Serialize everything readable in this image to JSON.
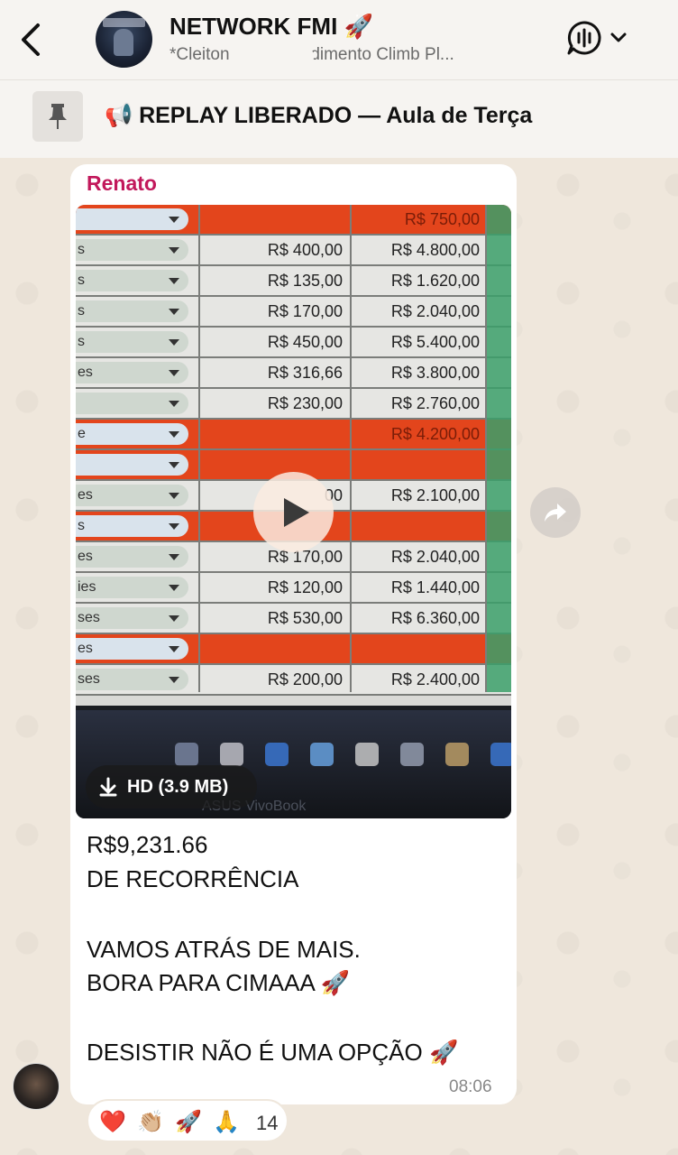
{
  "header": {
    "title": "NETWORK FMI 🚀",
    "subtitle": "*Cleiton ... ia, Atendimento Climb Pl..."
  },
  "pinned": {
    "text": "📢 REPLAY LIBERADO — Aula de Terça"
  },
  "message": {
    "sender": "Renato",
    "video": {
      "download_label": "HD (3.9 MB)",
      "spreadsheet_rows": [
        {
          "type": "red",
          "label": "",
          "col_b": "",
          "col_c": "R$ 750,00"
        },
        {
          "type": "gray",
          "label": "s",
          "col_b": "R$ 400,00",
          "col_c": "R$ 4.800,00"
        },
        {
          "type": "gray",
          "label": "s",
          "col_b": "R$ 135,00",
          "col_c": "R$ 1.620,00"
        },
        {
          "type": "gray",
          "label": "s",
          "col_b": "R$ 170,00",
          "col_c": "R$ 2.040,00"
        },
        {
          "type": "gray",
          "label": "s",
          "col_b": "R$ 450,00",
          "col_c": "R$ 5.400,00"
        },
        {
          "type": "gray",
          "label": "es",
          "col_b": "R$ 316,66",
          "col_c": "R$ 3.800,00"
        },
        {
          "type": "gray",
          "label": "",
          "col_b": "R$ 230,00",
          "col_c": "R$ 2.760,00"
        },
        {
          "type": "red",
          "label": "e",
          "col_b": "",
          "col_c": "R$ 4.200,00"
        },
        {
          "type": "red",
          "label": "",
          "col_b": "",
          "col_c": ""
        },
        {
          "type": "gray",
          "label": "es",
          "col_b": "00",
          "col_c": "R$ 2.100,00"
        },
        {
          "type": "red",
          "label": "s",
          "col_b": "",
          "col_c": ""
        },
        {
          "type": "gray",
          "label": "es",
          "col_b": "R$ 170,00",
          "col_c": "R$ 2.040,00"
        },
        {
          "type": "gray",
          "label": "ies",
          "col_b": "R$ 120,00",
          "col_c": "R$ 1.440,00"
        },
        {
          "type": "gray",
          "label": "ses",
          "col_b": "R$ 530,00",
          "col_c": "R$ 6.360,00"
        },
        {
          "type": "red",
          "label": "es",
          "col_b": "",
          "col_c": ""
        },
        {
          "type": "gray",
          "label": "ses",
          "col_b": "R$ 200,00",
          "col_c": "R$ 2.400,00"
        }
      ],
      "laptop_brand": "ASUS VivoBook"
    },
    "lines": [
      "R$9,231.66",
      "DE RECORRÊNCIA",
      "VAMOS ATRÁS DE MAIS.",
      "BORA PARA CIMAAA 🚀",
      "DESISTIR NÃO É UMA OPÇÃO 🚀"
    ],
    "time": "08:06",
    "reactions": {
      "emojis": [
        "❤️",
        "👏🏼",
        "🚀",
        "🙏"
      ],
      "count": "14"
    }
  },
  "colors": {
    "header_bg": "#f6f4f1",
    "chat_bg": "#efe7dc",
    "sender_name": "#c2185b",
    "sheet_red": "#e3451c"
  },
  "icons": [
    "back-chevron-icon",
    "call-waveform-icon",
    "chevron-down-icon",
    "pin-icon",
    "play-icon",
    "download-icon",
    "forward-icon"
  ]
}
